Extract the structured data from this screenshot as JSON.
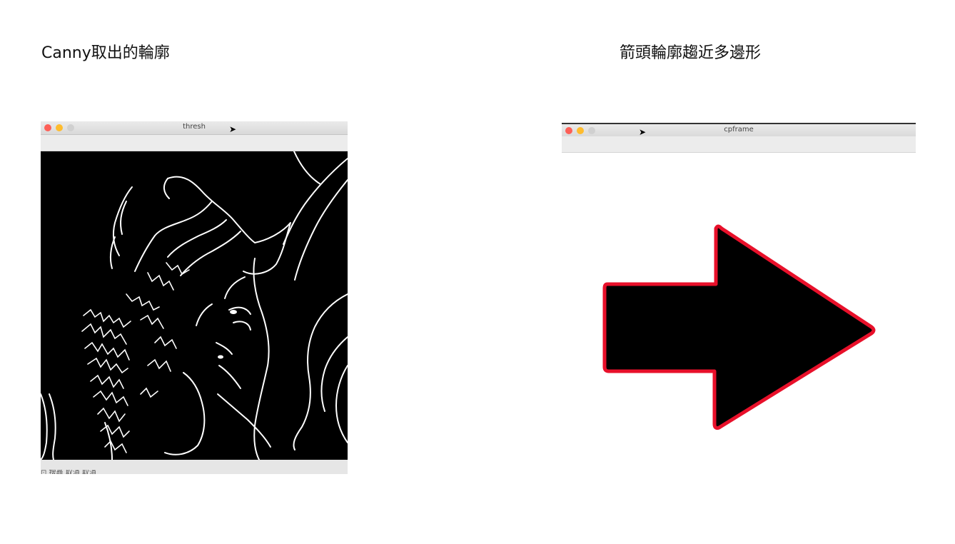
{
  "captions": {
    "left": "Canny取出的輪廓",
    "right": "箭頭輪廓趨近多邊形"
  },
  "left_window": {
    "title": "thresh",
    "status_text": "⊡ 搜尋 取消 取消"
  },
  "right_window": {
    "title": "cpframe"
  },
  "colors": {
    "contour": "#e8102a",
    "arrow_fill": "#000000",
    "edges": "#ffffff"
  },
  "icons": [
    "close-light",
    "minimize-light",
    "zoom-light",
    "cursor-icon"
  ]
}
